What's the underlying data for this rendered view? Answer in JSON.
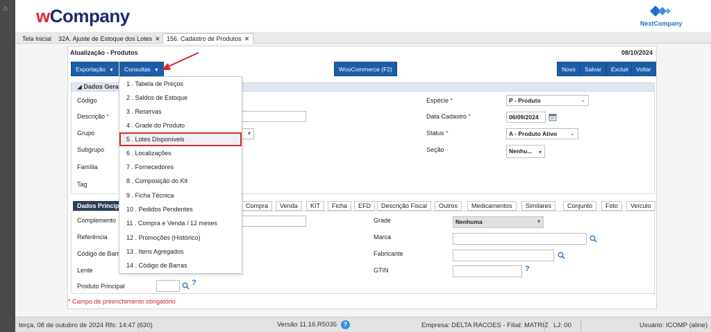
{
  "app": {
    "logo_w": "w",
    "logo_rest": "Company",
    "partner_logo": "NextCompany"
  },
  "tabs": [
    {
      "label": "Tela Inicial"
    },
    {
      "label": "32A. Ajuste de Estoque dos Lotes"
    },
    {
      "label": "156. Cadastro de Produtos"
    }
  ],
  "tab_close": "✕",
  "page": {
    "title": "Atualização - Produtos",
    "date": "08/10/2024"
  },
  "toolbar": {
    "exportacao": "Exportação",
    "consultas": "Consultas",
    "woocommerce": "WooCommerce (F2)",
    "novo": "Novo",
    "salvar": "Salvar",
    "excluir": "Excluir",
    "voltar": "Voltar",
    "caret": "▼"
  },
  "section1": {
    "header": "Dados Gerais",
    "codigo": "Código",
    "descricao": "Descrição",
    "grupo": "Grupo",
    "subgrupo": "Subgrupo",
    "familia": "Família",
    "tag": "Tag",
    "especie_label": "Espécie",
    "especie_value": "P - Produto",
    "data_cadastro_label": "Data Cadastro",
    "data_cadastro_value": "06/09/2024",
    "status_label": "Status",
    "status_value": "A - Produto Ativo",
    "secao_label": "Seção",
    "secao_value": "Nenhu...",
    "req": "*"
  },
  "tabs2": [
    "Dados Princip",
    "Compra",
    "Venda",
    "KIT",
    "Ficha",
    "EFD",
    "Descrição Fiscal",
    "Outros",
    "Medicamentos",
    "Similares",
    "Conjunto",
    "Foto",
    "Veículo"
  ],
  "section2": {
    "complemento": "Complemento",
    "referencia": "Referência",
    "codigo_barras": "Código de Barr",
    "lente": "Lente",
    "produto_principal": "Produto Principal",
    "grade_label": "Grade",
    "grade_value": "Nenhuma",
    "marca": "Marca",
    "fabricante": "Fabricante",
    "gtin": "GTIN",
    "help": "?"
  },
  "required_note": "* Campo de preenchimento obrigatório",
  "consultas_menu": [
    "1 . Tabela de Preços",
    "2 . Saldos de Estoque",
    "3 . Reservas",
    "4 . Grade do Produto",
    "5 . Lotes Disponíveis",
    "6 . Localizações",
    "7 . Fornecedores",
    "8 . Composição do Kit",
    "9 . Ficha Técnica",
    "10 . Pedidos Pendentes",
    "11 . Compra e Venda / 12 meses",
    "12 . Promoções (Histórico)",
    "13 . Itens Agregados",
    "14 . Código de Barras"
  ],
  "status": {
    "datetime": "terça, 08 de outubro de 2024  Rfs: 14:47 (630)",
    "version": "Versão 11.16.R5035",
    "help": "?",
    "empresa": "Empresa: DELTA RACOES - Filial: MATRIZ",
    "lj": "LJ: 00",
    "usuario": "Usuário: ICOMP (aline)"
  },
  "colors": {
    "button": "#1b5da8",
    "highlight": "#d32f2f",
    "tab_active": "#2c3e57"
  }
}
